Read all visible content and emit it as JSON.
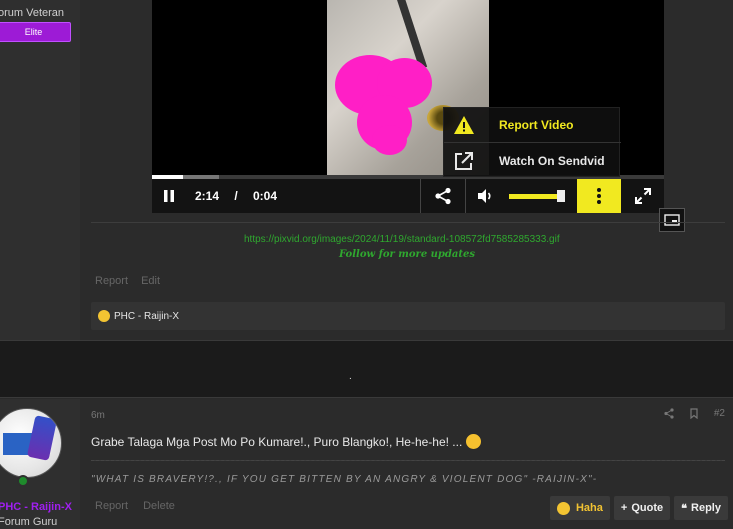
{
  "user_top": {
    "title": "orum Veteran",
    "badge": "Elite"
  },
  "video": {
    "current_time": "2:14",
    "separator": "/",
    "duration": "0:04",
    "progress_fraction": 0.06,
    "volume_fraction": 0.95,
    "menu": {
      "report_label": "Report Video",
      "sendvid_label": "Watch On Sendvid"
    },
    "accent_color": "#f1e920"
  },
  "post1": {
    "link": "https://pixvid.org/images/2024/11/19/standard-108572fd7585285333.gif",
    "follow_text": "Follow for more updates",
    "actions": [
      "Report",
      "Edit"
    ],
    "reactions_text": "PHC - Raijin-X"
  },
  "separator_dot": ".",
  "post2": {
    "time": "6m",
    "post_number": "#2",
    "body": "Grabe Talaga Mga Post Mo Po Kumare!., Puro Blangko!, He-he-he! ...",
    "signature": "\"WHAT IS BRAVERY!?., IF YOU GET BITTEN BY AN ANGRY & VIOLENT DOG\" -RAIJIN-X\"-",
    "actions": [
      "Report",
      "Delete"
    ],
    "buttons": {
      "haha": "Haha",
      "quote": "Quote",
      "reply": "Reply"
    },
    "user": {
      "name": "PHC - Raijin-X",
      "title": "Forum Guru"
    }
  }
}
